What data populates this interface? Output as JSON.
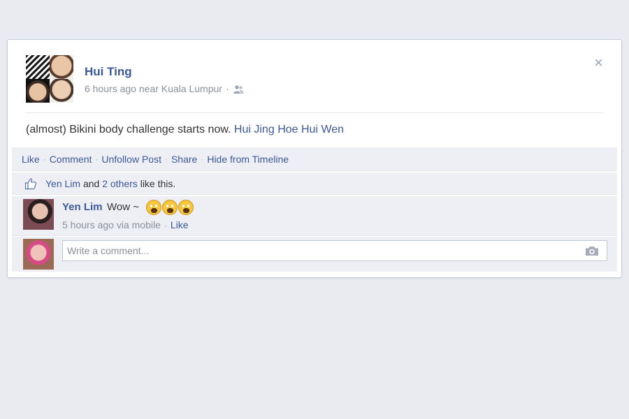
{
  "post": {
    "author": "Hui Ting",
    "time": "6 hours ago",
    "near": "near",
    "location": "Kuala Lumpur",
    "status_text": "(almost) Bikini body challenge starts now.",
    "tagged": [
      "Hui Jing",
      "Hoe Hui Wen"
    ],
    "close_label": "×"
  },
  "actions": [
    "Like",
    "Comment",
    "Unfollow Post",
    "Share",
    "Hide from Timeline"
  ],
  "likes": {
    "first_name": "Yen Lim",
    "and": "and",
    "others_link": "2 others",
    "suffix": "like this."
  },
  "comment": {
    "author": "Yen Lim",
    "text": "Wow ~",
    "time": "5 hours ago via mobile",
    "like_label": "Like",
    "emoji_count": 3
  },
  "write_comment": {
    "placeholder": "Write a comment..."
  },
  "colors": {
    "link": "#3b5998",
    "background": "#e9ebf0",
    "ufi_bg": "#edeff4",
    "meta": "#8a8f99"
  },
  "icons": [
    "close-icon",
    "friends-icon",
    "thumbs-up-icon",
    "camera-icon",
    "scream-emoji-icon"
  ]
}
